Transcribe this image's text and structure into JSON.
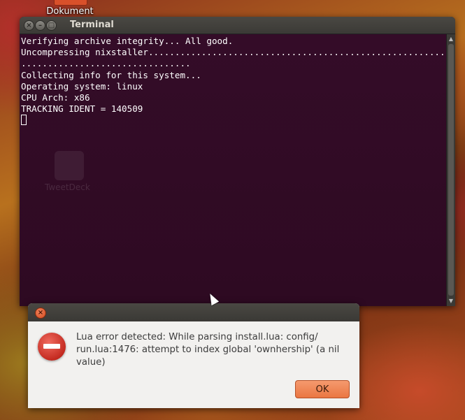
{
  "desktop": {
    "icon_label": "Dokument",
    "ghost_icon_label": "TweetDeck"
  },
  "terminal": {
    "title": "Terminal",
    "lines": [
      "Verifying archive integrity... All good.",
      "Uncompressing nixstaller............................................................",
      "................................",
      "Collecting info for this system...",
      "Operating system: linux",
      "CPU Arch: x86",
      "TRACKING IDENT = 140509"
    ]
  },
  "dialog": {
    "message": "Lua error detected: While parsing install.lua: config/ run.lua:1476: attempt to index global 'ownhership' (a nil value)",
    "ok_label": "OK"
  },
  "colors": {
    "terminal_bg": "#300a24",
    "ok_button": "#ea7642",
    "error_icon": "#c42b21"
  }
}
